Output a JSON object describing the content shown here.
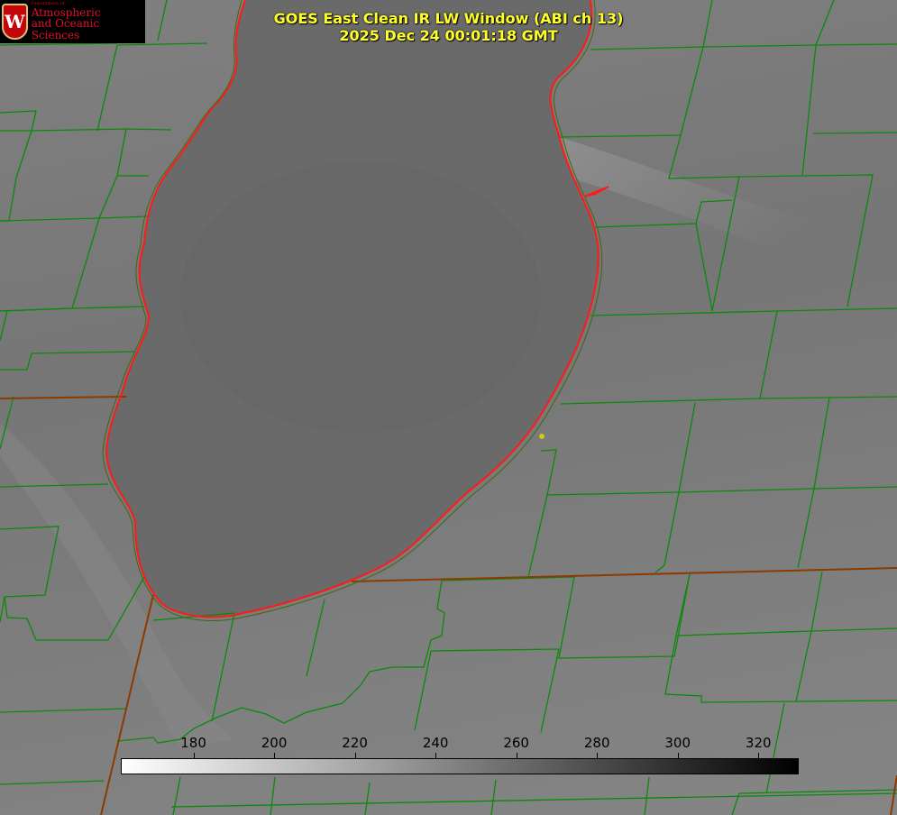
{
  "title": {
    "line1": "GOES East Clean IR LW Window (ABI ch 13)",
    "line2": "2025 Dec 24 00:01:18 GMT"
  },
  "logo": {
    "crest_letter": "W",
    "department": "Department of",
    "line1": "Atmospheric",
    "line2": "and Oceanic Sciences"
  },
  "colorbar": {
    "ticks": [
      "180",
      "200",
      "220",
      "240",
      "260",
      "280",
      "300",
      "320"
    ],
    "range": [
      162,
      330
    ],
    "color_min": "#ffffff",
    "color_max": "#000000"
  },
  "colors": {
    "county_lines": "#0a8a0a",
    "lake_shoreline": "#ff1a1a",
    "state_lines": "#8b3a00",
    "marker": "#d6c418"
  }
}
